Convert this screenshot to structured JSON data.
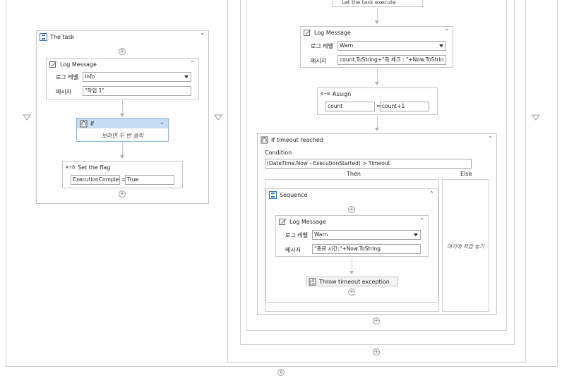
{
  "task_sequence": {
    "title": "The task",
    "log_message": {
      "title": "Log Message",
      "level_label": "로그 레벨",
      "level_value": "Info",
      "message_label": "메시지",
      "message_value": "\"작업 1\""
    },
    "if_activity": {
      "title": "If",
      "hint": "보려면 두 번 클릭"
    },
    "assign": {
      "title": "Set the flag",
      "to": "ExecutionComplet",
      "equals": "=",
      "value": "True"
    }
  },
  "right_flow": {
    "top_step_label": "Let the task execute",
    "log_message": {
      "title": "Log Message",
      "level_label": "로그 레벨",
      "level_value": "Warn",
      "message_label": "메시지",
      "message_value": "count.ToString+\"회 체크 : \"+Now.ToStrin"
    },
    "assign": {
      "title": "Assign",
      "to": "count",
      "equals": "=",
      "value": "count+1"
    },
    "if_timeout": {
      "title": "If timeout reached",
      "condition_label": "Condition",
      "condition_value": "(DateTime.Now - ExecutionStarted) > Timeout",
      "then_label": "Then",
      "else_label": "Else",
      "else_placeholder": "여기에 작업 놓기",
      "sequence": {
        "title": "Sequence",
        "log_message": {
          "title": "Log Message",
          "level_label": "로그 레벨",
          "level_value": "Warn",
          "message_label": "메시지",
          "message_value": "\"종료 시간:\"+Now.ToString"
        },
        "throw": {
          "title": "Throw timeout exception"
        }
      }
    }
  },
  "colors": {
    "if_header": "#c6dff5",
    "border": "#c6c6c6"
  }
}
